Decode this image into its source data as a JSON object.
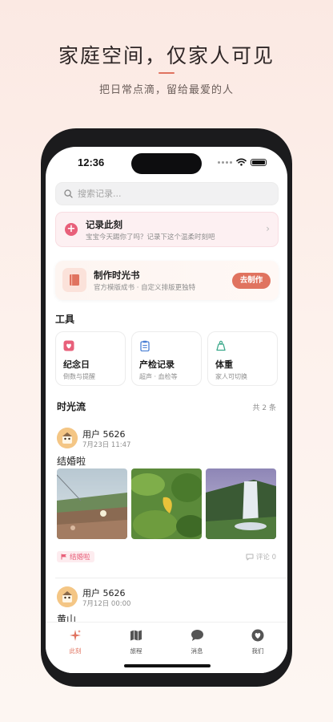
{
  "promo": {
    "headline": "家庭空间，仅家人可见",
    "subheadline": "把日常点滴，留给最爱的人"
  },
  "status_bar": {
    "time": "12:36"
  },
  "search": {
    "placeholder": "搜索记录..."
  },
  "record_card": {
    "title": "记录此刻",
    "subtitle": "宝宝今天踢你了吗？记录下这个温柔时刻吧"
  },
  "book_card": {
    "title": "制作时光书",
    "subtitle": "官方模版成书 · 自定义排版更独特",
    "button": "去制作"
  },
  "tools": {
    "title": "工具",
    "items": [
      {
        "name": "纪念日",
        "sub": "倒数与提醒",
        "icon": "heart-icon",
        "color": "#e8607a"
      },
      {
        "name": "产检记录",
        "sub": "超声 · 血检等",
        "icon": "clipboard-icon",
        "color": "#4a7fd4"
      },
      {
        "name": "体重",
        "sub": "家人可切换",
        "icon": "scale-icon",
        "color": "#3aa88a"
      }
    ]
  },
  "timeline": {
    "title": "时光流",
    "count": "共 2 条",
    "posts": [
      {
        "user": "用户 5626",
        "date": "7月23日 11:47",
        "text": "结婚啦",
        "photos": [
          "coastal-flowers-photo",
          "yellow-leaf-photo",
          "waterfall-photo"
        ],
        "tag": "结婚啦",
        "comment": "评论 0"
      },
      {
        "user": "用户 5626",
        "date": "7月12日 00:00",
        "text": "黄山"
      }
    ]
  },
  "tabbar": {
    "items": [
      {
        "label": "此刻",
        "icon": "sparkle-icon",
        "active": true
      },
      {
        "label": "旅程",
        "icon": "map-icon",
        "active": false
      },
      {
        "label": "消息",
        "icon": "chat-icon",
        "active": false
      },
      {
        "label": "我们",
        "icon": "heart-icon",
        "active": false
      }
    ]
  },
  "colors": {
    "accent": "#e0735f",
    "pink": "#e8607a",
    "background": "#fbe9e3"
  }
}
